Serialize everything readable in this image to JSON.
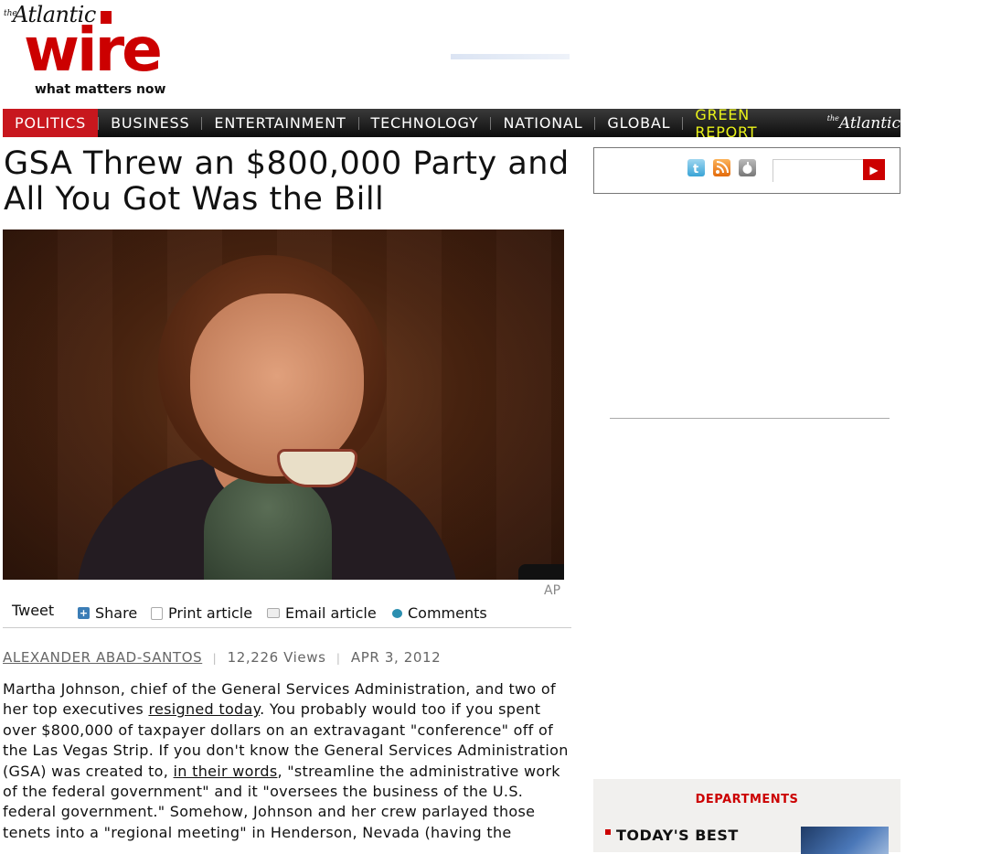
{
  "brand": {
    "the": "the",
    "atlantic": "Atlantic",
    "wire": "wire",
    "tagline": "what matters now"
  },
  "nav": {
    "items": [
      {
        "label": "POLITICS",
        "active": true
      },
      {
        "label": "BUSINESS"
      },
      {
        "label": "ENTERTAINMENT"
      },
      {
        "label": "TECHNOLOGY"
      },
      {
        "label": "NATIONAL"
      },
      {
        "label": "GLOBAL"
      },
      {
        "label": "GREEN REPORT"
      }
    ],
    "atlantic_the": "the",
    "atlantic_logo": "Atlantic"
  },
  "article": {
    "headline": "GSA Threw an $800,000 Party and All You Got Was the Bill",
    "photo_credit": "AP",
    "share": {
      "tweet": "Tweet",
      "share": "Share",
      "print": "Print article",
      "email": "Email article",
      "comments": "Comments"
    },
    "byline": {
      "author": "ALEXANDER ABAD-SANTOS",
      "views": "12,226 Views",
      "date": "APR 3, 2012"
    },
    "body": {
      "p1_a": "Martha Johnson, chief of the General Services Administration, and two of her top executives ",
      "link1": "resigned today",
      "p1_b": ". You probably would too if you spent over $800,000 of taxpayer dollars on an extravagant \"conference\" off of the Las Vegas Strip. If you don't know the General Services Administration (GSA) was created to, ",
      "link2": "in their words",
      "p1_c": ", \"streamline the administrative work of the federal government\" and it \"oversees the business of the U.S. federal government.\"  Somehow, Johnson and her crew parlayed those tenets into a \"regional meeting\" in Henderson, Nevada (having the"
    }
  },
  "sidebar": {
    "social_icons": [
      "twitter-icon",
      "rss-icon",
      "apple-icon"
    ],
    "search_placeholder": "",
    "departments_title": "DEPARTMENTS",
    "departments_first": "TODAY'S BEST"
  },
  "colors": {
    "brand_red": "#c8171e",
    "green_report": "#e9f21a"
  }
}
